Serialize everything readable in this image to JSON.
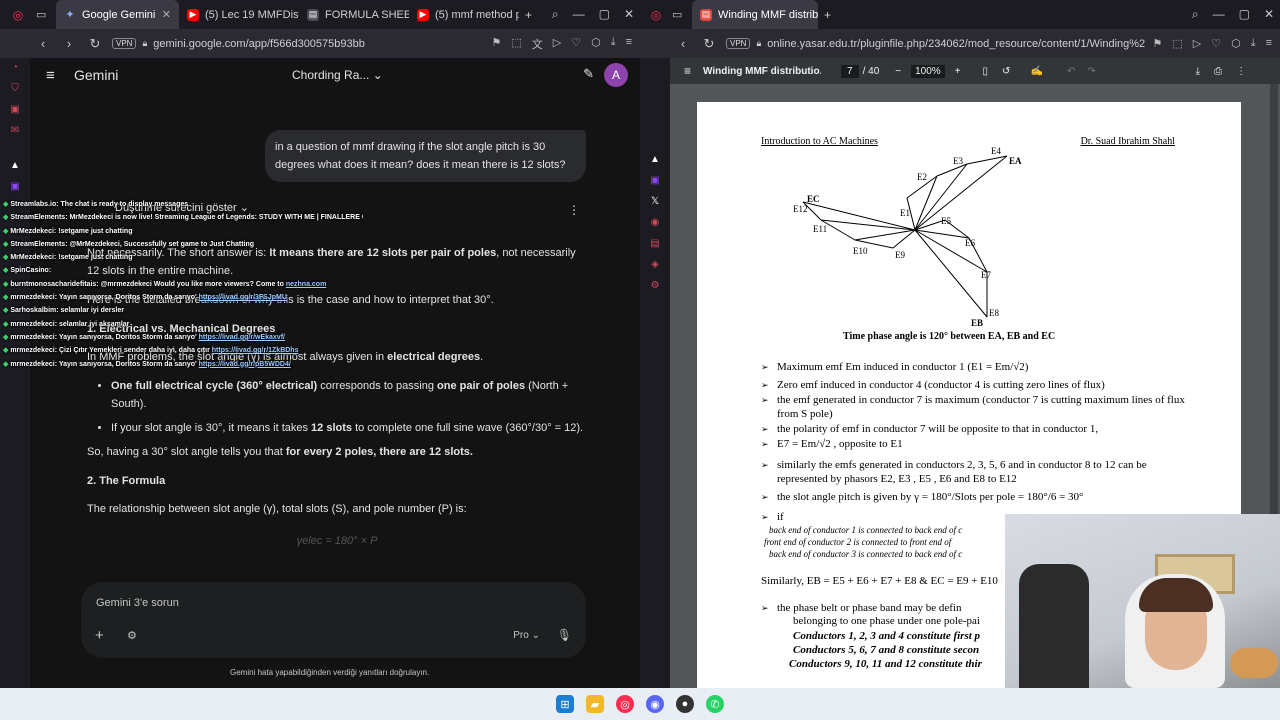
{
  "left_browser": {
    "tabs": [
      {
        "label": "Google Gemini",
        "icon": "gemini-icon",
        "active": true
      },
      {
        "label": "(5) Lec 19 MMFDistrib",
        "icon": "youtube-icon"
      },
      {
        "label": "FORMULA SHEET-VE",
        "icon": "doc-icon"
      },
      {
        "label": "(5) mmf method phas",
        "icon": "youtube-icon"
      }
    ],
    "vpn": "VPN",
    "url": "gemini.google.com/app/f566d300575b93bb"
  },
  "gemini": {
    "brand": "Gemini",
    "model_title": "Chording Ra...",
    "avatar": "A",
    "user_question": "in a question of mmf drawing if the slot angle pitch is 30 degrees what does it mean? does it mean there is 12 slots?",
    "thinking_label": "Düşünme sürecini göster",
    "answer_p1_a": "Not necessarily. The short answer is: ",
    "answer_p1_b": "It means there are 12 slots per pair of poles",
    "answer_p1_c": ", not necessarily 12 slots in the entire machine.",
    "answer_p2": "Here is the detailed breakdown of why this is the case and how to interpret that 30°.",
    "h1": "1. Electrical vs. Mechanical Degrees",
    "p3_a": "In MMF problems, the slot angle (γ) is almost always given in ",
    "p3_b": "electrical degrees",
    "p3_c": ".",
    "li1_a": "One full electrical cycle (360° electrical)",
    "li1_b": " corresponds to passing ",
    "li1_c": "one pair of poles",
    "li1_d": " (North + South).",
    "li2_a": "If your slot angle is 30°, it means it takes ",
    "li2_b": "12 slots",
    "li2_c": " to complete one full sine wave (360°/30° = 12).",
    "p4_a": "So, having a 30° slot angle tells you that ",
    "p4_b": "for every 2 poles, there are 12 slots.",
    "h2": "2. The Formula",
    "p5": "The relationship between slot angle (γ), total slots (S), and pole number (P) is:",
    "formula_fade": "γelec = 180° × P",
    "input_placeholder": "Gemini 3'e sorun",
    "mode": "Pro",
    "disclaimer": "Gemini hata yapabildiğinden verdiği yanıtları doğrulayın."
  },
  "stream_chat": [
    {
      "user": "Streamlabs.io",
      "msg": "The chat is ready to display messages"
    },
    {
      "user": "StreamElements",
      "msg": "MrMezdekeci is now live! Streaming League of Legends: STUDY WITH ME | FINALLERE CALISIYORUM |"
    },
    {
      "user": "MrMezdekeci",
      "msg": "!setgame just chatting"
    },
    {
      "user": "StreamElements",
      "msg": "@MrMezdekeci, Successfully set game to Just Chatting"
    },
    {
      "user": "MrMezdekeci",
      "msg": "!setgame just chatting"
    },
    {
      "user": "SpinCasino",
      "msg": ""
    },
    {
      "user": "burntmonosacharidefitais",
      "msg": "@mrmezdekeci Would you like more viewers? Come to",
      "link": "nezhna.com"
    },
    {
      "user": "mrmezdekeci",
      "msg": "Yayın sanıyorsa, Doritos Storm da sarıyo'",
      "link": "https://livad.gg/r/3FSJpMU"
    },
    {
      "user": "Sarhoskalbim",
      "msg": "selamlar iyi dersler"
    },
    {
      "user": "mrmezdekeci",
      "msg": "selamlar iyi akşamlar"
    },
    {
      "user": "mrmezdekeci",
      "msg": "Yayın sanıyorsa, Doritos Storm da sarıyo'",
      "link": "https://livad.gg/r/wEkaxvf/"
    },
    {
      "user": "mrmezdekeci",
      "msg": "Çizi Çıtır Yemekleri sender daha iyi, daha çıtır",
      "link": "https://livad.gg/r/1ZkBDhs"
    },
    {
      "user": "mrmezdekeci",
      "msg": "Yayın sanıyorsa, Doritos Storm da sarıyo'",
      "link": "https://livad.gg/r/pB5WDD4/"
    }
  ],
  "right_browser": {
    "tabs": [
      {
        "label": "Winding MMF distribution",
        "icon": "pdf-icon",
        "active": true
      }
    ],
    "vpn": "VPN",
    "url": "online.yasar.edu.tr/pluginfile.php/234062/mod_resource/content/1/Winding%2"
  },
  "pdf": {
    "title": "Winding MMF distributio...",
    "page": "7",
    "total": "/ 40",
    "zoom": "100%",
    "header_left": "Introduction to AC Machines",
    "header_right": "Dr. Suad Ibrahim Shahl",
    "phasor_labels": [
      "E4",
      "EA",
      "E3",
      "E2",
      "E1",
      "EC",
      "E12",
      "E11",
      "E10",
      "E9",
      "E5",
      "E6",
      "E7",
      "E8",
      "EB"
    ],
    "caption": "Time phase angle is 120° between EA, EB and EC",
    "bullets": [
      "Maximum emf  Em  induced in  conductor 1 (E1 = Em/√2)",
      "Zero emf  induced in conductor 4 (conductor 4 is cutting zero lines of flux)",
      "the emf generated in conductor 7 is maximum (conductor 7 is cutting maximum lines of flux from S pole)",
      "the polarity of emf  in  conductor 7 will be opposite to that in conductor 1,",
      "E7 = Em/√2 , opposite to E1",
      "similarly the emfs generated in conductors 2, 3, 5, 6 and in conductor 8 to 12 can be represented by phasors  E2, E3 , E5 , E6 and E8 to E12",
      "the slot angle pitch is given by γ = 180°/Slots per pole = 180°/6 = 30°",
      "if"
    ],
    "if_lines": [
      "back end of conductor 1 is connected to back end of c",
      "front end of conductor 2 is connected to front end of",
      "back end of conductor 3 is connected to back end of c"
    ],
    "similarly": "Similarly, EB = E5 + E6 + E7 + E8  &  EC = E9 + E10",
    "phase_belt": "the phase belt or phase band may be defin",
    "belonging": "belonging to one phase under one pole-pai",
    "conductors": [
      "Conductors 1, 2, 3 and 4 constitute first p",
      "Conductors 5, 6, 7 and 8 constitute secon",
      "Conductors 9, 10, 11 and 12 constitute thir"
    ]
  }
}
